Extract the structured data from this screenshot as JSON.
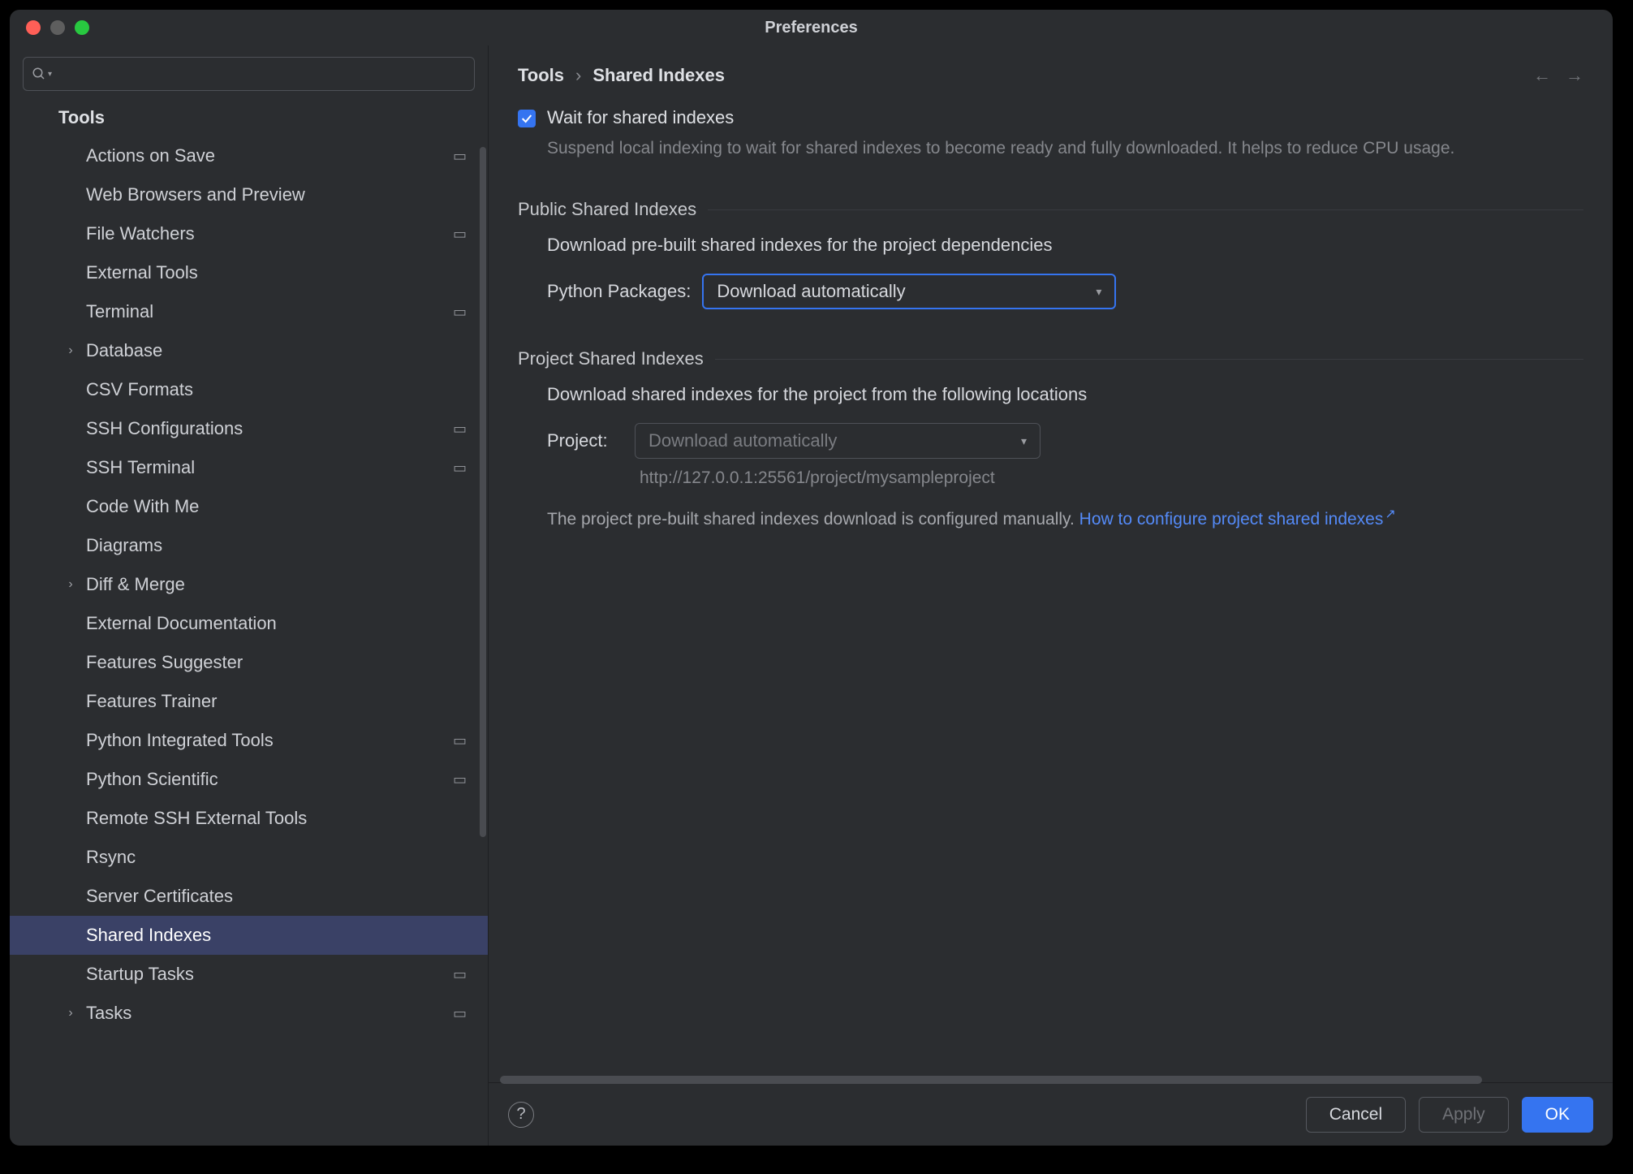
{
  "window": {
    "title": "Preferences"
  },
  "search": {
    "placeholder": ""
  },
  "breadcrumb": {
    "parent": "Tools",
    "sep": "›",
    "current": "Shared Indexes"
  },
  "sidebar": {
    "group_title": "Tools",
    "items": [
      {
        "label": "Actions on Save",
        "chev": false,
        "proj": true,
        "selected": false
      },
      {
        "label": "Web Browsers and Preview",
        "chev": false,
        "proj": false,
        "selected": false
      },
      {
        "label": "File Watchers",
        "chev": false,
        "proj": true,
        "selected": false
      },
      {
        "label": "External Tools",
        "chev": false,
        "proj": false,
        "selected": false
      },
      {
        "label": "Terminal",
        "chev": false,
        "proj": true,
        "selected": false
      },
      {
        "label": "Database",
        "chev": true,
        "proj": false,
        "selected": false
      },
      {
        "label": "CSV Formats",
        "chev": false,
        "proj": false,
        "selected": false
      },
      {
        "label": "SSH Configurations",
        "chev": false,
        "proj": true,
        "selected": false
      },
      {
        "label": "SSH Terminal",
        "chev": false,
        "proj": true,
        "selected": false
      },
      {
        "label": "Code With Me",
        "chev": false,
        "proj": false,
        "selected": false
      },
      {
        "label": "Diagrams",
        "chev": false,
        "proj": false,
        "selected": false
      },
      {
        "label": "Diff & Merge",
        "chev": true,
        "proj": false,
        "selected": false
      },
      {
        "label": "External Documentation",
        "chev": false,
        "proj": false,
        "selected": false
      },
      {
        "label": "Features Suggester",
        "chev": false,
        "proj": false,
        "selected": false
      },
      {
        "label": "Features Trainer",
        "chev": false,
        "proj": false,
        "selected": false
      },
      {
        "label": "Python Integrated Tools",
        "chev": false,
        "proj": true,
        "selected": false
      },
      {
        "label": "Python Scientific",
        "chev": false,
        "proj": true,
        "selected": false
      },
      {
        "label": "Remote SSH External Tools",
        "chev": false,
        "proj": false,
        "selected": false
      },
      {
        "label": "Rsync",
        "chev": false,
        "proj": false,
        "selected": false
      },
      {
        "label": "Server Certificates",
        "chev": false,
        "proj": false,
        "selected": false
      },
      {
        "label": "Shared Indexes",
        "chev": false,
        "proj": false,
        "selected": true
      },
      {
        "label": "Startup Tasks",
        "chev": false,
        "proj": true,
        "selected": false
      },
      {
        "label": "Tasks",
        "chev": true,
        "proj": true,
        "selected": false
      }
    ]
  },
  "wait_checkbox": {
    "label": "Wait for shared indexes",
    "help": "Suspend local indexing to wait for shared indexes to become ready and fully downloaded. It helps to reduce CPU usage."
  },
  "public_section": {
    "title": "Public Shared Indexes",
    "desc": "Download pre-built shared indexes for the project dependencies",
    "field_label": "Python Packages:",
    "select_value": "Download automatically"
  },
  "project_section": {
    "title": "Project Shared Indexes",
    "desc": "Download shared indexes for the project from the following locations",
    "field_label": "Project:",
    "select_value": "Download automatically",
    "url": "http://127.0.0.1:25561/project/mysampleproject",
    "note_prefix": "The project pre-built shared indexes download is configured manually. ",
    "note_link": "How to configure project shared indexes"
  },
  "footer": {
    "cancel": "Cancel",
    "apply": "Apply",
    "ok": "OK"
  }
}
